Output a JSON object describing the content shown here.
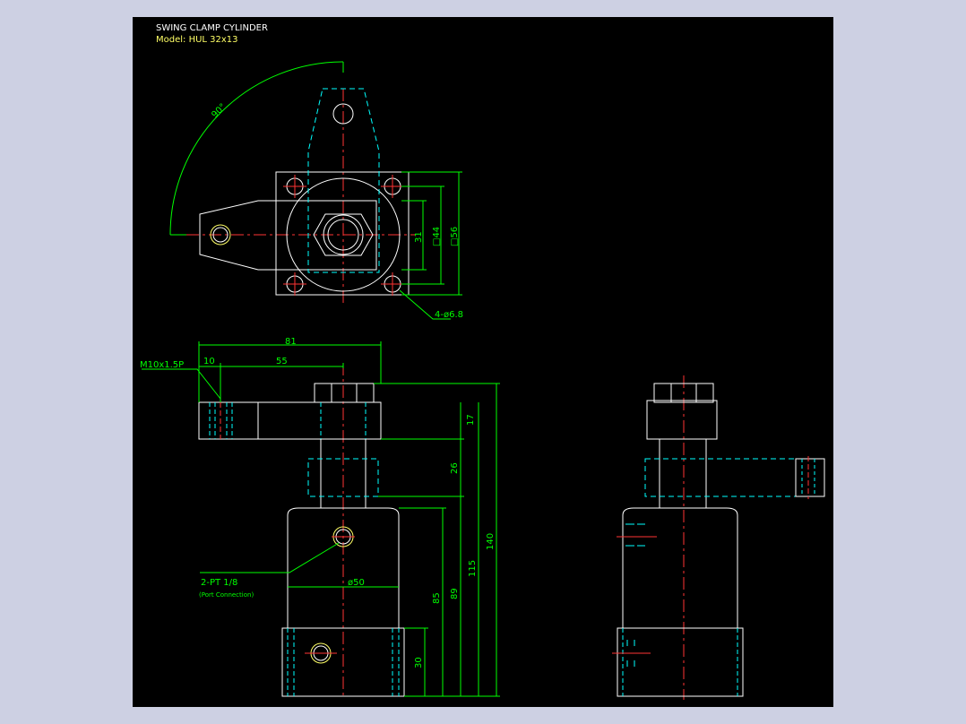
{
  "title": {
    "line1": "SWING CLAMP CYLINDER",
    "line2": "Model: HUL 32x13"
  },
  "dims": {
    "angle": "90°",
    "d31": "31",
    "d44": "□44",
    "d56": "□56",
    "holes": "4-ø6.8",
    "d81": "81",
    "d10": "10",
    "d55": "55",
    "thread": "M10x1.5P",
    "d17": "17",
    "d26": "26",
    "d140": "140",
    "d115": "115",
    "d89": "89",
    "d85": "85",
    "d30": "30",
    "d50": "ø50",
    "port": "2-PT 1/8",
    "port_note": "(Port Connection)"
  },
  "colors": {
    "background": "#000000",
    "outline": "#ffffff",
    "dimension": "#00ff00",
    "hidden": "#00ffff",
    "center": "#ff0000",
    "port": "#ffff00",
    "frame": "#cdd0e3"
  }
}
